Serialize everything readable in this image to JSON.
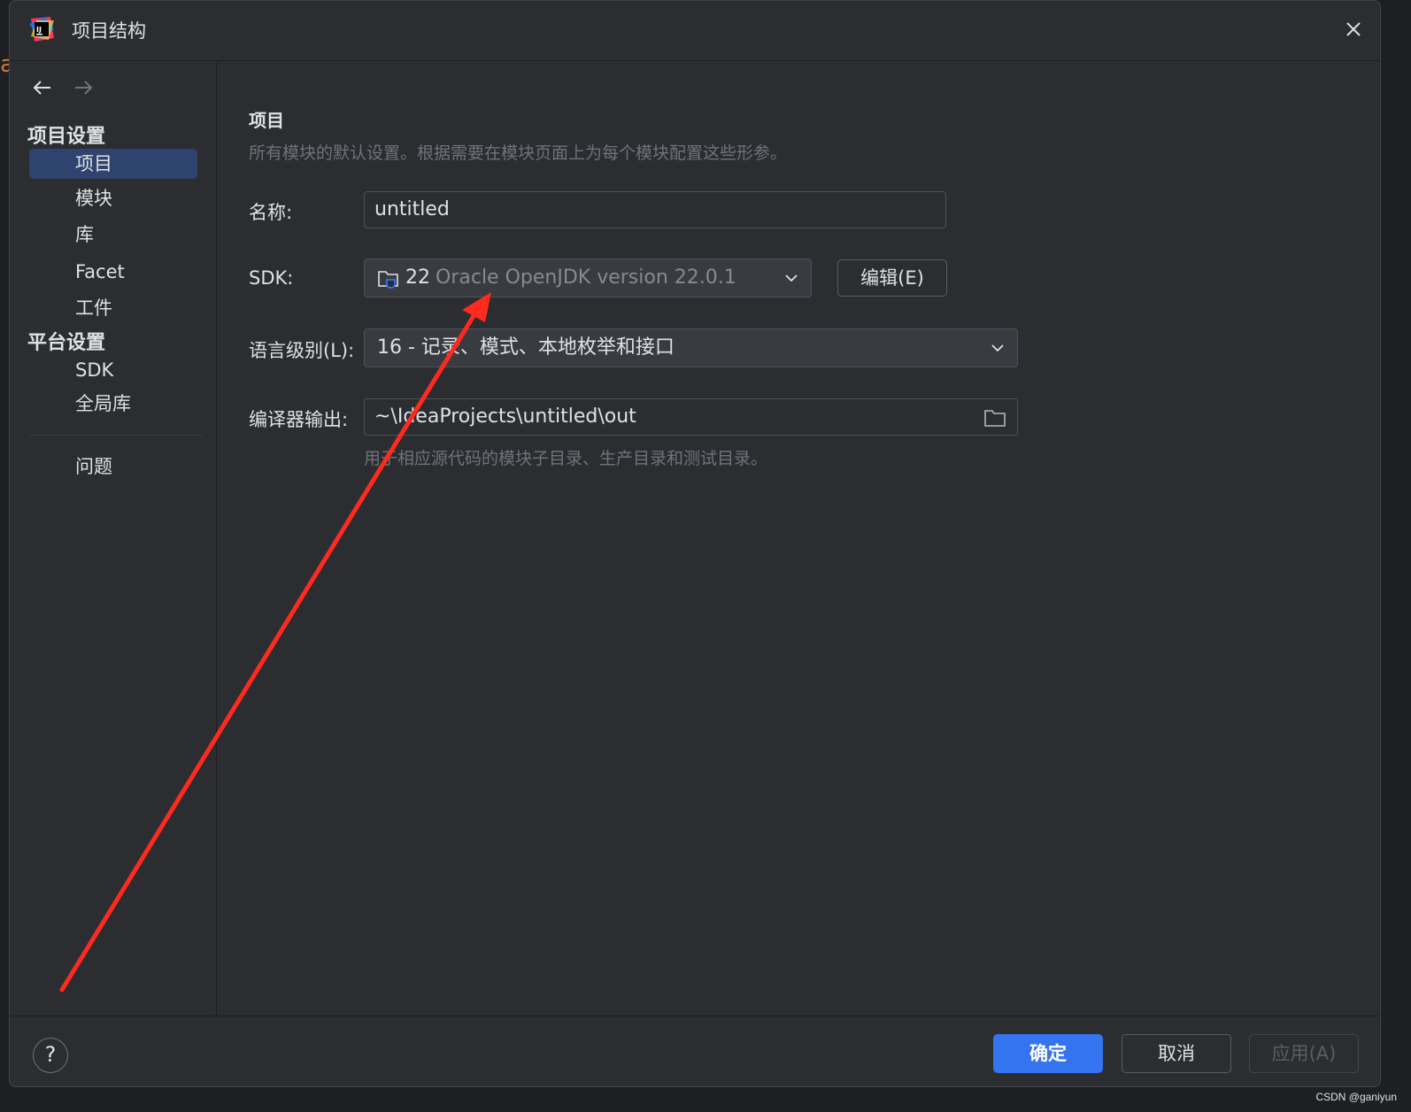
{
  "window": {
    "title": "项目结构"
  },
  "sidebar": {
    "section_project": "项目设置",
    "section_platform": "平台设置",
    "items": [
      {
        "label": "项目"
      },
      {
        "label": "模块"
      },
      {
        "label": "库"
      },
      {
        "label": "Facet"
      },
      {
        "label": "工件"
      },
      {
        "label": "SDK"
      },
      {
        "label": "全局库"
      },
      {
        "label": "问题"
      }
    ],
    "selected": "项目"
  },
  "main": {
    "heading": "项目",
    "description": "所有模块的默认设置。根据需要在模块页面上为每个模块配置这些形参。",
    "name_label": "名称:",
    "name_value": "untitled",
    "sdk_label": "SDK:",
    "sdk_version": "22",
    "sdk_name": "Oracle OpenJDK version 22.0.1",
    "edit_button": "编辑(E)",
    "language_level_label": "语言级别(L):",
    "language_level_value": "16 - 记录、模式、本地枚举和接口",
    "compiler_output_label": "编译器输出:",
    "compiler_output_value": "~\\IdeaProjects\\untitled\\out",
    "compiler_output_hint": "用于相应源代码的模块子目录、生产目录和测试目录。"
  },
  "footer": {
    "help": "?",
    "ok": "确定",
    "cancel": "取消",
    "apply": "应用(A)"
  },
  "watermark": "CSDN @ganiyun",
  "colors": {
    "accent": "#3574f0",
    "selection": "#2e436e",
    "annotation_arrow": "#ff2a1f"
  }
}
